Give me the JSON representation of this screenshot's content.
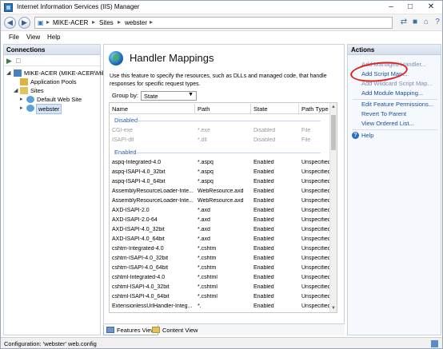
{
  "window": {
    "title": "Internet Information Services (IIS) Manager"
  },
  "address": {
    "crumbs": [
      "MIKE-ACER",
      "Sites",
      "webster"
    ]
  },
  "menu": [
    "File",
    "View",
    "Help"
  ],
  "connections": {
    "title": "Connections",
    "tree": [
      {
        "label": "MIKE-ACER (MIKE-ACER\\Mik",
        "level": 0
      },
      {
        "label": "Application Pools",
        "level": 1
      },
      {
        "label": "Sites",
        "level": 1
      },
      {
        "label": "Default Web Site",
        "level": 2
      },
      {
        "label": "webster",
        "level": 2
      }
    ]
  },
  "feature": {
    "title": "Handler Mappings",
    "description": "Use this feature to specify the resources, such as DLLs and managed code, that handle responses for specific request types.",
    "group_by_label": "Group by:",
    "group_by_value": "State",
    "columns": [
      "Name",
      "Path",
      "State",
      "Path Type"
    ],
    "groups": [
      {
        "name": "Disabled",
        "rows": [
          [
            "CGI-exe",
            "*.exe",
            "Disabled",
            "File"
          ],
          [
            "ISAPI-dll",
            "*.dll",
            "Disabled",
            "File"
          ]
        ]
      },
      {
        "name": "Enabled",
        "rows": [
          [
            "aspq-Integrated-4.0",
            "*.aspq",
            "Enabled",
            "Unspecified"
          ],
          [
            "aspq-ISAPI-4.0_32bit",
            "*.aspq",
            "Enabled",
            "Unspecified"
          ],
          [
            "aspq-ISAPI-4.0_64bit",
            "*.aspq",
            "Enabled",
            "Unspecified"
          ],
          [
            "AssemblyResourceLoader-Inte...",
            "WebResource.axd",
            "Enabled",
            "Unspecified"
          ],
          [
            "AssemblyResourceLoader-Inte...",
            "WebResource.axd",
            "Enabled",
            "Unspecified"
          ],
          [
            "AXD-ISAPI-2.0",
            "*.axd",
            "Enabled",
            "Unspecified"
          ],
          [
            "AXD-ISAPI-2.0-64",
            "*.axd",
            "Enabled",
            "Unspecified"
          ],
          [
            "AXD-ISAPI-4.0_32bit",
            "*.axd",
            "Enabled",
            "Unspecified"
          ],
          [
            "AXD-ISAPI-4.0_64bit",
            "*.axd",
            "Enabled",
            "Unspecified"
          ],
          [
            "cshtm-Integrated-4.0",
            "*.cshtm",
            "Enabled",
            "Unspecified"
          ],
          [
            "cshtm-ISAPI-4.0_32bit",
            "*.cshtm",
            "Enabled",
            "Unspecified"
          ],
          [
            "cshtm-ISAPI-4.0_64bit",
            "*.cshtm",
            "Enabled",
            "Unspecified"
          ],
          [
            "cshtml-Integrated-4.0",
            "*.cshtml",
            "Enabled",
            "Unspecified"
          ],
          [
            "cshtml-ISAPI-4.0_32bit",
            "*.cshtml",
            "Enabled",
            "Unspecified"
          ],
          [
            "cshtml-ISAPI-4.0_64bit",
            "*.cshtml",
            "Enabled",
            "Unspecified"
          ],
          [
            "ExtensionlessUrlHandler-Integ...",
            "*.",
            "Enabled",
            "Unspecified"
          ]
        ]
      }
    ],
    "view_tabs": [
      "Features View",
      "Content View"
    ]
  },
  "actions": {
    "title": "Actions",
    "items": [
      "Add Managed Handler...",
      "Add Script Map...",
      "Add Wildcard Script Map...",
      "Add Module Mapping...",
      "Edit Feature Permissions...",
      "Revert To Parent",
      "View Ordered List...",
      "Help"
    ]
  },
  "status": {
    "text": "Configuration: 'webster' web.config"
  }
}
